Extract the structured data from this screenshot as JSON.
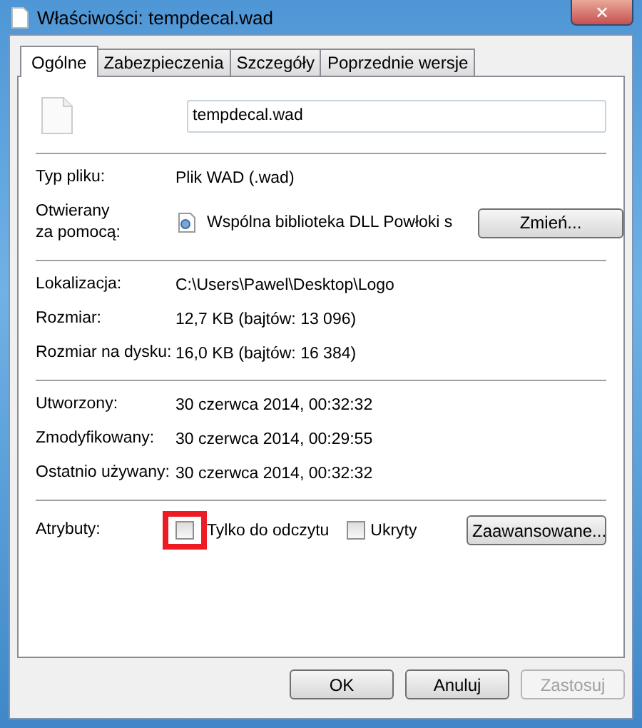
{
  "window": {
    "title": "Właściwości: tempdecal.wad",
    "close": "✕"
  },
  "tabs": [
    {
      "label": "Ogólne",
      "selected": true
    },
    {
      "label": "Zabezpieczenia",
      "selected": false
    },
    {
      "label": "Szczegóły",
      "selected": false
    },
    {
      "label": "Poprzednie wersje",
      "selected": false
    }
  ],
  "file_name": "tempdecal.wad",
  "sections": [
    [
      {
        "label": "Typ pliku:",
        "value": "Plik WAD (.wad)"
      },
      {
        "label": "Otwierany\nza pomocą:",
        "value": "Wspólna biblioteka DLL Powłoki s",
        "kind": "opens_with",
        "button": "Zmień..."
      }
    ],
    [
      {
        "label": "Lokalizacja:",
        "value": "C:\\Users\\Pawel\\Desktop\\Logo"
      },
      {
        "label": "Rozmiar:",
        "value": "12,7 KB (bajtów: 13 096)"
      },
      {
        "label": "Rozmiar na dysku:",
        "value": "16,0 KB (bajtów: 16 384)"
      }
    ],
    [
      {
        "label": "Utworzony:",
        "value": "30 czerwca 2014, 00:32:32"
      },
      {
        "label": "Zmodyfikowany:",
        "value": "30 czerwca 2014, 00:29:55"
      },
      {
        "label": "Ostatnio używany:",
        "value": "30 czerwca 2014, 00:32:32"
      }
    ]
  ],
  "attributes": {
    "label": "Atrybuty:",
    "items": [
      {
        "label": "Tylko do odczytu",
        "checked": false,
        "highlighted": true
      },
      {
        "label": "Ukryty",
        "checked": false,
        "highlighted": false
      }
    ],
    "button": "Zaawansowane..."
  },
  "buttons": [
    {
      "label": "OK",
      "disabled": false
    },
    {
      "label": "Anuluj",
      "disabled": false
    },
    {
      "label": "Zastosuj",
      "disabled": true
    }
  ]
}
